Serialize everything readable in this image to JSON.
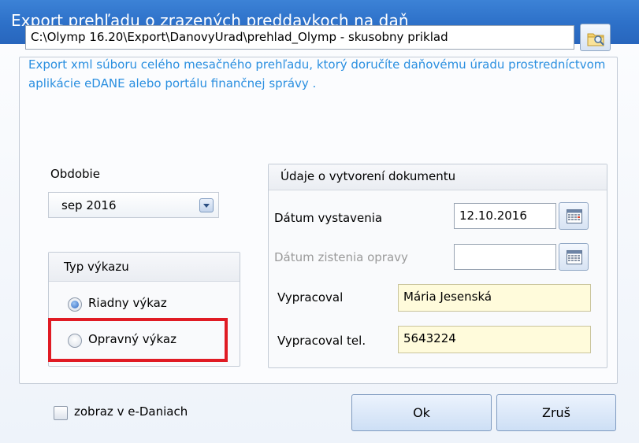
{
  "window": {
    "title": "Export prehľadu o zrazených preddavkoch na daň"
  },
  "path": {
    "value": "C:\\Olymp 16.20\\Export\\DanovyUrad\\prehlad_Olymp - skusobny priklad"
  },
  "info_text": "Export xml súboru celého mesačného prehľadu, ktorý doručíte daňovému úradu prostredníctvom aplikácie eDANE alebo portálu finančnej správy .",
  "period": {
    "label": "Obdobie",
    "value": "sep 2016"
  },
  "report_type": {
    "title": "Typ výkazu",
    "options": [
      {
        "label": "Riadny výkaz",
        "checked": true
      },
      {
        "label": "Opravný výkaz",
        "checked": false
      }
    ]
  },
  "document": {
    "title": "Údaje o vytvorení dokumentu",
    "issue_date_label": "Dátum vystavenia",
    "issue_date_value": "12.10.2016",
    "correction_date_label": "Dátum zistenia opravy",
    "correction_date_value": "",
    "prepared_by_label": "Vypracoval",
    "prepared_by_value": "Mária Jesenská",
    "phone_label": "Vypracoval tel.",
    "phone_value": "5643224"
  },
  "footer": {
    "checkbox_label": "zobraz v e-Daniach",
    "checkbox_checked": false,
    "ok_label": "Ok",
    "cancel_label": "Zruš"
  },
  "colors": {
    "title_bar": "#2d70c8",
    "info_text": "#2a8fe0",
    "highlight_box": "#e01b24",
    "input_yellow": "#fffbdb"
  },
  "icons": {
    "browse": "folder-search-icon",
    "calendar": "calendar-icon",
    "dropdown": "chevron-down-icon"
  }
}
